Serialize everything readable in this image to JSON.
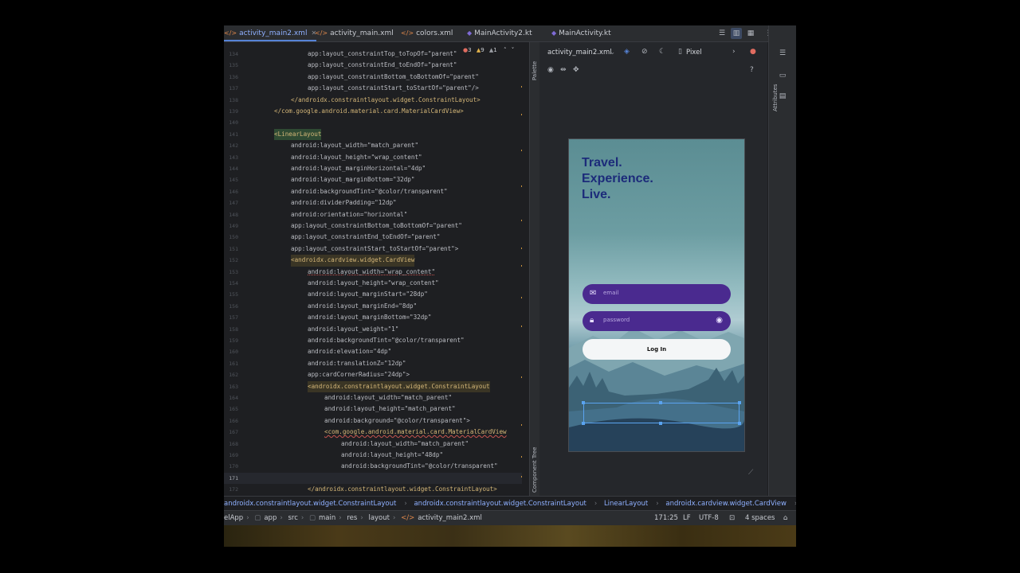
{
  "tabs": [
    {
      "label": "activity_main2.xml",
      "type": "xml",
      "active": true
    },
    {
      "label": "activity_main.xml",
      "type": "xml",
      "active": false
    },
    {
      "label": "colors.xml",
      "type": "xml",
      "active": false
    },
    {
      "label": "MainActivity2.kt",
      "type": "kt",
      "active": false
    },
    {
      "label": "MainActivity.kt",
      "type": "kt",
      "active": false
    }
  ],
  "editor_indicators": {
    "errors": "3",
    "warnings": "9",
    "weak": "1"
  },
  "code_lines": [
    {
      "n": "134",
      "text": "app:layout_constraintTop_toTopOf=\"parent\""
    },
    {
      "n": "135",
      "text": "app:layout_constraintEnd_toEndOf=\"parent\""
    },
    {
      "n": "136",
      "text": "app:layout_constraintBottom_toBottomOf=\"parent\""
    },
    {
      "n": "137",
      "text": "app:layout_constraintStart_toStartOf=\"parent\"/>"
    },
    {
      "n": "138",
      "text": "</androidx.constraintlayout.widget.ConstraintLayout>"
    },
    {
      "n": "139",
      "text": "</com.google.android.material.card.MaterialCardView>"
    },
    {
      "n": "140",
      "text": ""
    },
    {
      "n": "141",
      "text": "<LinearLayout"
    },
    {
      "n": "142",
      "text": "android:layout_width=\"match_parent\""
    },
    {
      "n": "143",
      "text": "android:layout_height=\"wrap_content\""
    },
    {
      "n": "144",
      "text": "android:layout_marginHorizontal=\"4dp\""
    },
    {
      "n": "145",
      "text": "android:layout_marginBottom=\"32dp\""
    },
    {
      "n": "146",
      "text": "android:backgroundTint=\"@color/transparent\""
    },
    {
      "n": "147",
      "text": "android:dividerPadding=\"12dp\""
    },
    {
      "n": "148",
      "text": "android:orientation=\"horizontal\""
    },
    {
      "n": "149",
      "text": "app:layout_constraintBottom_toBottomOf=\"parent\""
    },
    {
      "n": "150",
      "text": "app:layout_constraintEnd_toEndOf=\"parent\""
    },
    {
      "n": "151",
      "text": "app:layout_constraintStart_toStartOf=\"parent\">"
    },
    {
      "n": "152",
      "text": "<androidx.cardview.widget.CardView"
    },
    {
      "n": "153",
      "text": "android:layout_width=\"wrap_content\""
    },
    {
      "n": "154",
      "text": "android:layout_height=\"wrap_content\""
    },
    {
      "n": "155",
      "text": "android:layout_marginStart=\"28dp\""
    },
    {
      "n": "156",
      "text": "android:layout_marginEnd=\"8dp\""
    },
    {
      "n": "157",
      "text": "android:layout_marginBottom=\"32dp\""
    },
    {
      "n": "158",
      "text": "android:layout_weight=\"1\""
    },
    {
      "n": "159",
      "text": "android:backgroundTint=\"@color/transparent\""
    },
    {
      "n": "160",
      "text": "android:elevation=\"4dp\""
    },
    {
      "n": "161",
      "text": "android:translationZ=\"12dp\""
    },
    {
      "n": "162",
      "text": "app:cardCornerRadius=\"24dp\">"
    },
    {
      "n": "163",
      "text": "<androidx.constraintlayout.widget.ConstraintLayout"
    },
    {
      "n": "164",
      "text": "android:layout_width=\"match_parent\""
    },
    {
      "n": "165",
      "text": "android:layout_height=\"match_parent\""
    },
    {
      "n": "166",
      "text": "android:background=\"@color/transparent\">"
    },
    {
      "n": "167",
      "text": "<com.google.android.material.card.MaterialCardView"
    },
    {
      "n": "168",
      "text": "android:layout_width=\"match_parent\""
    },
    {
      "n": "169",
      "text": "android:layout_height=\"48dp\""
    },
    {
      "n": "170",
      "text": "android:backgroundTint=\"@color/transparent\""
    },
    {
      "n": "171",
      "text": ""
    },
    {
      "n": "172",
      "text": "</androidx.constraintlayout.widget.ConstraintLayout>"
    }
  ],
  "preview": {
    "file_label": "activity_main2.xml",
    "device_label": "Pixel",
    "side_labels": {
      "palette": "Palette",
      "component_tree": "Component Tree",
      "attributes": "Attributes"
    },
    "app_title_lines": [
      "Travel.",
      "Experience.",
      "Live."
    ],
    "email_placeholder": "email",
    "password_placeholder": "password",
    "login_label": "Log In"
  },
  "breadcrumb": [
    "androidx.constraintlayout.widget.ConstraintLayout",
    "androidx.constraintlayout.widget.ConstraintLayout",
    "LinearLayout",
    "androidx.cardview.widget.CardView",
    "android"
  ],
  "status": {
    "path": [
      "elApp",
      "app",
      "src",
      "main",
      "res",
      "layout",
      "activity_main2.xml"
    ],
    "position": "171:25",
    "line_sep": "LF",
    "encoding": "UTF-8",
    "indent": "4 spaces"
  },
  "colors": {
    "accent": "#5683d6",
    "field_purple": "#4a2a8f",
    "title_blue": "#1c2b7a",
    "selection": "#5aa3f0"
  }
}
